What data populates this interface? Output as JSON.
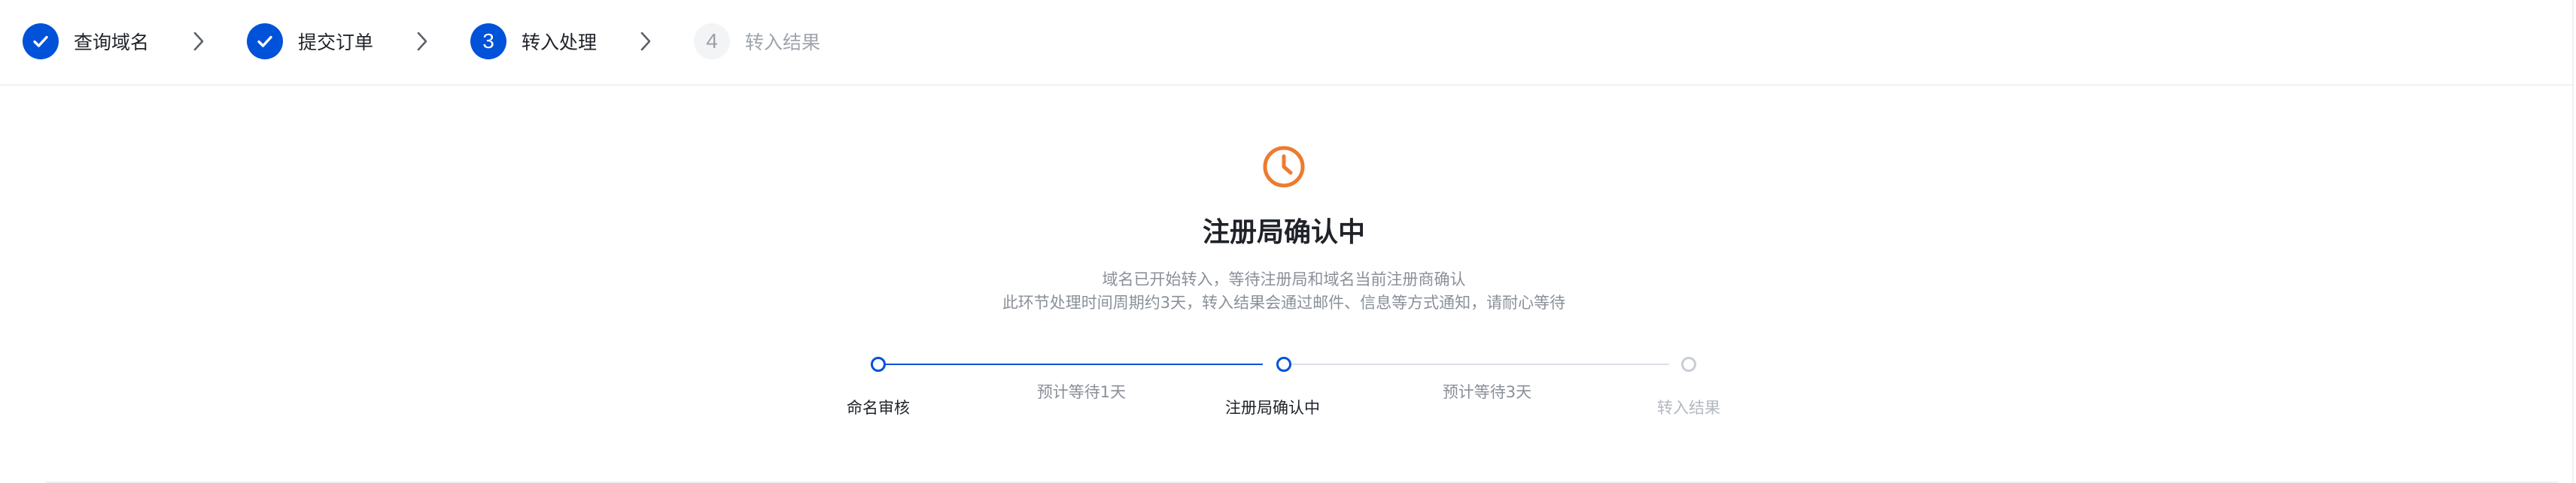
{
  "stepper": {
    "steps": [
      {
        "number": "1",
        "label": "查询域名",
        "state": "done"
      },
      {
        "number": "2",
        "label": "提交订单",
        "state": "done"
      },
      {
        "number": "3",
        "label": "转入处理",
        "state": "active"
      },
      {
        "number": "4",
        "label": "转入结果",
        "state": "todo"
      }
    ]
  },
  "status": {
    "icon": "clock-icon",
    "icon_color": "#ed7b2f",
    "title": "注册局确认中",
    "description_line1": "域名已开始转入，等待注册局和域名当前注册商确认",
    "description_line2": "此环节处理时间周期约3天，转入结果会通过邮件、信息等方式通知，请耐心等待"
  },
  "progress": {
    "nodes": [
      {
        "label": "命名审核",
        "state": "done"
      },
      {
        "label": "注册局确认中",
        "state": "done"
      },
      {
        "label": "转入结果",
        "state": "todo"
      }
    ],
    "estimates": [
      "预计等待1天",
      "预计等待3天"
    ]
  },
  "colors": {
    "accent": "#0052d9",
    "warning": "#ed7b2f",
    "muted_text": "#8a9099"
  }
}
